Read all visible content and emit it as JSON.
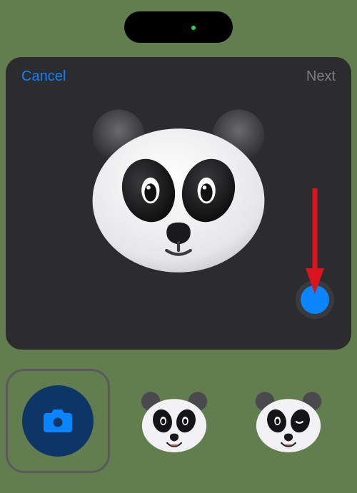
{
  "modal": {
    "cancel_label": "Cancel",
    "next_label": "Next"
  },
  "icons": {
    "island_dot": "indicator-dot",
    "capture": "capture-button",
    "camera": "camera-icon",
    "panda_main": "panda-memoji",
    "panda_thumb_a": "panda-memoji-smile",
    "panda_thumb_b": "panda-memoji-wink"
  },
  "annotation": {
    "arrow_color": "#d9141e"
  },
  "colors": {
    "accent": "#0a84ff",
    "background": "#627e4e",
    "sheet": "#2c2c2e",
    "disabled_text": "#7d7d82",
    "camera_fill": "#0d3566"
  }
}
